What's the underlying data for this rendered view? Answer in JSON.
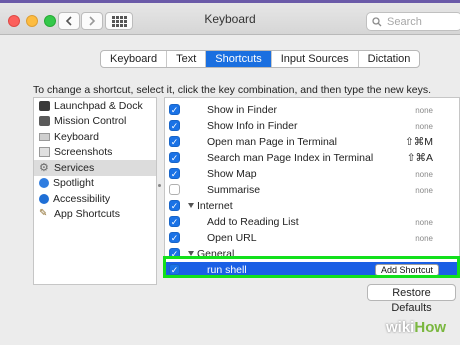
{
  "window": {
    "title": "Keyboard",
    "search_placeholder": "Search"
  },
  "tabs": [
    {
      "label": "Keyboard",
      "active": false
    },
    {
      "label": "Text",
      "active": false
    },
    {
      "label": "Shortcuts",
      "active": true
    },
    {
      "label": "Input Sources",
      "active": false
    },
    {
      "label": "Dictation",
      "active": false
    }
  ],
  "instructions": "To change a shortcut, select it, click the key combination, and then type the new keys.",
  "categories": [
    {
      "label": "Launchpad & Dock",
      "icon": "launchpad-dock-icon",
      "selected": false
    },
    {
      "label": "Mission Control",
      "icon": "mission-control-icon",
      "selected": false
    },
    {
      "label": "Keyboard",
      "icon": "keyboard-icon",
      "selected": false
    },
    {
      "label": "Screenshots",
      "icon": "screenshots-icon",
      "selected": false
    },
    {
      "label": "Services",
      "icon": "gear-icon",
      "selected": true
    },
    {
      "label": "Spotlight",
      "icon": "spotlight-icon",
      "selected": false
    },
    {
      "label": "Accessibility",
      "icon": "accessibility-icon",
      "selected": false
    },
    {
      "label": "App Shortcuts",
      "icon": "app-shortcuts-icon",
      "selected": false
    }
  ],
  "shortcuts": [
    {
      "type": "item",
      "label": "Show in Finder",
      "shortcut": "none",
      "checked": true
    },
    {
      "type": "item",
      "label": "Show Info in Finder",
      "shortcut": "none",
      "checked": true
    },
    {
      "type": "item",
      "label": "Open man Page in Terminal",
      "shortcut": "⇧⌘M",
      "checked": true
    },
    {
      "type": "item",
      "label": "Search man Page Index in Terminal",
      "shortcut": "⇧⌘A",
      "checked": true
    },
    {
      "type": "item",
      "label": "Show Map",
      "shortcut": "none",
      "checked": true
    },
    {
      "type": "item",
      "label": "Summarise",
      "shortcut": "none",
      "checked": false
    },
    {
      "type": "group",
      "label": "Internet",
      "checked": true
    },
    {
      "type": "item",
      "label": "Add to Reading List",
      "shortcut": "none",
      "checked": true
    },
    {
      "type": "item",
      "label": "Open URL",
      "shortcut": "none",
      "checked": true
    },
    {
      "type": "group",
      "label": "General",
      "checked": true
    },
    {
      "type": "item",
      "label": "run shell",
      "shortcut": "",
      "checked": true,
      "highlighted": true,
      "button": "Add Shortcut"
    }
  ],
  "restore_label": "Restore Defaults",
  "watermark": {
    "part1": "wiki",
    "part2": "How"
  },
  "colors": {
    "accent": "#1a6fe0",
    "highlight_box": "#12e01b"
  }
}
